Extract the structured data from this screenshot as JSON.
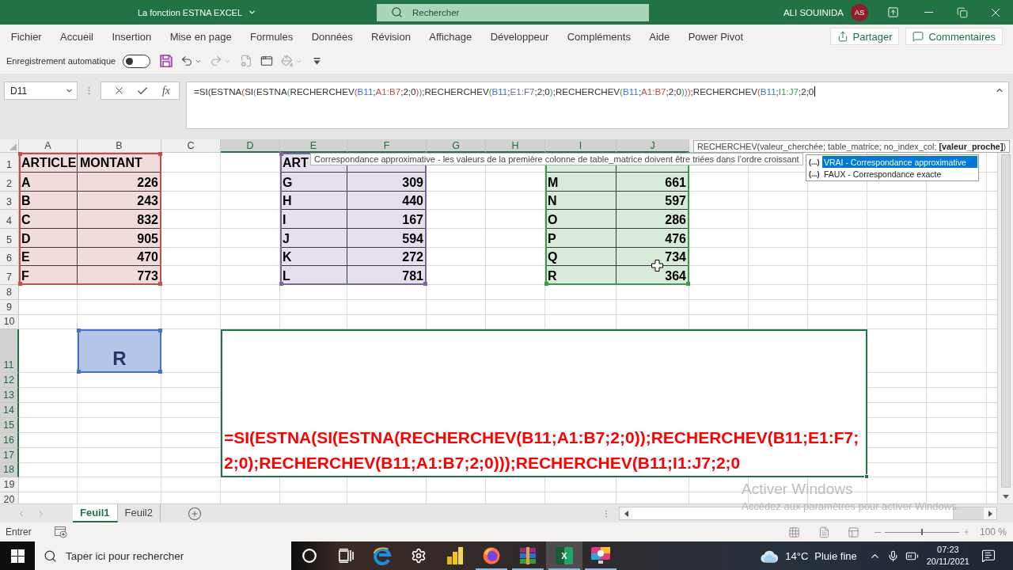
{
  "title_bar": {
    "title": "La fonction ESTNA EXCEL",
    "search_placeholder": "Rechercher",
    "user_name": "ALI SOUINIDA",
    "user_initials": "AS"
  },
  "ribbon": {
    "tabs": [
      "Fichier",
      "Accueil",
      "Insertion",
      "Mise en page",
      "Formules",
      "Données",
      "Révision",
      "Affichage",
      "Développeur",
      "Compléments",
      "Aide",
      "Power Pivot"
    ],
    "actions": [
      {
        "kind": "share",
        "label": "Partager"
      },
      {
        "kind": "comments",
        "label": "Commentaires"
      }
    ]
  },
  "quick_access": {
    "autosave_label": "Enregistrement automatique",
    "autosave_on": false,
    "tools": [
      {
        "kind": "save",
        "disabled": false
      },
      {
        "kind": "undo",
        "disabled": false
      },
      {
        "kind": "redo",
        "disabled": true
      },
      {
        "kind": "preview",
        "disabled": true
      },
      {
        "kind": "form",
        "disabled": false
      },
      {
        "kind": "fill",
        "disabled": true
      },
      {
        "kind": "customize",
        "disabled": false
      }
    ]
  },
  "formula_bar": {
    "name_box": "D11",
    "function_label": "fx",
    "formula": "=SI(ESTNA(SI(ESTNA(RECHERCHEV(B11;A1:B7;2;0));RECHERCHEV(B11;E1:F7;2;0);RECHERCHEV(B11;A1:B7;2;0)));RECHERCHEV(B11;I1:J7;2;0"
  },
  "sheet": {
    "columns": [
      {
        "label": "A",
        "selected": false
      },
      {
        "label": "B",
        "selected": false
      },
      {
        "label": "C",
        "selected": false
      },
      {
        "label": "D",
        "selected": true
      },
      {
        "label": "E",
        "selected": true
      },
      {
        "label": "F",
        "selected": true
      },
      {
        "label": "G",
        "selected": true
      },
      {
        "label": "H",
        "selected": true
      },
      {
        "label": "I",
        "selected": true
      },
      {
        "label": "J",
        "selected": true
      }
    ],
    "rows": [
      {
        "label": "1",
        "selected": false
      },
      {
        "label": "2",
        "selected": false
      },
      {
        "label": "3",
        "selected": false
      },
      {
        "label": "4",
        "selected": false
      },
      {
        "label": "5",
        "selected": false
      },
      {
        "label": "6",
        "selected": false
      },
      {
        "label": "7",
        "selected": false
      },
      {
        "label": "8",
        "selected": false
      },
      {
        "label": "9",
        "selected": false
      },
      {
        "label": "10",
        "selected": false
      },
      {
        "label": "11",
        "selected": true
      },
      {
        "label": "12",
        "selected": true
      },
      {
        "label": "13",
        "selected": true
      },
      {
        "label": "14",
        "selected": true
      },
      {
        "label": "15",
        "selected": true
      },
      {
        "label": "16",
        "selected": true
      },
      {
        "label": "17",
        "selected": true
      },
      {
        "label": "18",
        "selected": true
      },
      {
        "label": "19",
        "selected": false
      },
      {
        "label": "20",
        "selected": false
      }
    ],
    "tables": [
      {
        "color": "#c0504d",
        "header": [
          "ARTICLE",
          "MONTANT"
        ],
        "rows": [
          [
            "A",
            "226"
          ],
          [
            "B",
            "243"
          ],
          [
            "C",
            "832"
          ],
          [
            "D",
            "905"
          ],
          [
            "E",
            "470"
          ],
          [
            "F",
            "773"
          ]
        ]
      },
      {
        "color": "#8064a2",
        "header": [
          "ART"
        ],
        "rows": [
          [
            "G",
            "309"
          ],
          [
            "H",
            "440"
          ],
          [
            "I",
            "167"
          ],
          [
            "J",
            "594"
          ],
          [
            "K",
            "272"
          ],
          [
            "L",
            "781"
          ]
        ]
      },
      {
        "color": "#3b9a4c",
        "rows": [
          [
            "M",
            "661"
          ],
          [
            "N",
            "597"
          ],
          [
            "O",
            "286"
          ],
          [
            "P",
            "476"
          ],
          [
            "Q",
            "734"
          ],
          [
            "R",
            "364"
          ]
        ]
      }
    ],
    "lookup_cell": {
      "value": "R"
    },
    "active_cell": {
      "text": "=SI(ESTNA(SI(ESTNA(RECHERCHEV(B11;A1:B7;2;0));RECHERCHEV(B11;E1:F7;2;0);RECHERCHEV(B11;A1:B7;2;0)));RECHERCHEV(B11;I1:J7;2;0"
    }
  },
  "argument_tip": "RECHERCHEV(valeur_cherchée; table_matrice; no_index_col; **[valeur_proche]**)",
  "hint_tip": "Correspondance approximative - les valeurs de la première colonne de table_matrice doivent être triées dans l’ordre croissant",
  "autocomplete": [
    {
      "marker": "(...)",
      "label": "VRAI - Correspondance approximative",
      "selected": true
    },
    {
      "marker": "(...)",
      "label": "FAUX - Correspondance exacte",
      "selected": false
    }
  ],
  "sheet_tabs": [
    {
      "label": "Feuil1",
      "selected": true
    },
    {
      "label": "Feuil2",
      "selected": false
    }
  ],
  "status_bar": {
    "mode": "Entrer",
    "zoom_slider": {
      "level": 0.5
    },
    "zoom": "100 %"
  },
  "watermark": {
    "title": "Activer Windows",
    "text": "Accédez aux paramètres pour activer Windows."
  },
  "taskbar": {
    "search_placeholder": "Taper ici pour rechercher",
    "apps": [
      {
        "kind": "ring",
        "open": false,
        "selected": false
      },
      {
        "kind": "task_view",
        "open": false,
        "selected": false
      },
      {
        "kind": "browser",
        "open": false,
        "selected": false
      },
      {
        "kind": "gear",
        "open": false,
        "selected": false
      },
      {
        "kind": "bars",
        "open": false,
        "selected": false
      },
      {
        "kind": "fox",
        "open": true,
        "selected": false
      },
      {
        "kind": "archive",
        "open": true,
        "selected": false
      },
      {
        "kind": "spreadsheet",
        "glyph": "X",
        "open": true,
        "selected": true
      },
      {
        "kind": "screen",
        "open": true,
        "selected": false
      }
    ],
    "weather": {
      "temperature": "14°C",
      "condition": "Pluie fine"
    },
    "clock": {
      "time": "07:23",
      "date": "20/11/2021"
    }
  }
}
